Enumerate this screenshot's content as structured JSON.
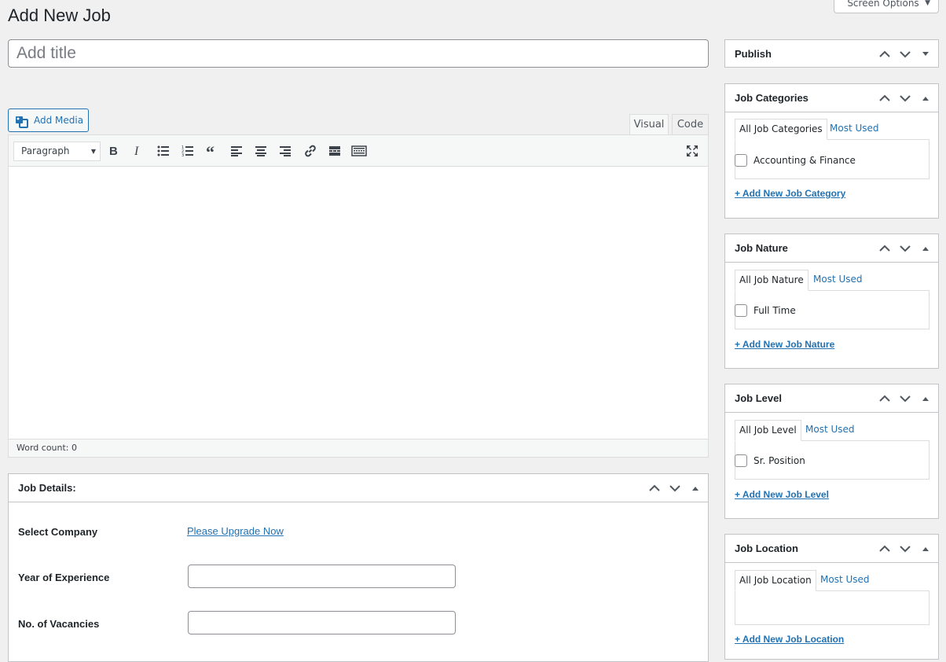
{
  "page": {
    "title": "Add New Job",
    "screen_options": "Screen Options"
  },
  "title_field": {
    "placeholder": "Add title"
  },
  "editor": {
    "add_media": "Add Media",
    "tab_visual": "Visual",
    "tab_code": "Code",
    "format_select": "Paragraph",
    "toolbar": [
      "bold-icon",
      "italic-icon",
      "bullet-list-icon",
      "numbered-list-icon",
      "blockquote-icon",
      "align-left-icon",
      "align-center-icon",
      "align-right-icon",
      "link-icon",
      "read-more-icon",
      "toolbar-toggle-icon",
      "fullscreen-icon"
    ],
    "word_count": "Word count: 0"
  },
  "job_details": {
    "title": "Job Details:",
    "select_company_label": "Select Company",
    "select_company_link": "Please Upgrade Now",
    "experience_label": "Year of Experience",
    "experience_value": "",
    "vacancies_label": "No. of Vacancies",
    "vacancies_value": ""
  },
  "sidebar": {
    "publish": {
      "title": "Publish"
    },
    "categories": {
      "title": "Job Categories",
      "tab_all": "All Job Categories",
      "tab_most": "Most Used",
      "items": [
        "Accounting & Finance"
      ],
      "add_link": "+ Add New Job Category"
    },
    "nature": {
      "title": "Job Nature",
      "tab_all": "All Job Nature",
      "tab_most": "Most Used",
      "items": [
        "Full Time"
      ],
      "add_link": "+ Add New Job Nature"
    },
    "level": {
      "title": "Job Level",
      "tab_all": "All Job Level",
      "tab_most": "Most Used",
      "items": [
        "Sr. Position"
      ],
      "add_link": "+ Add New Job Level"
    },
    "location": {
      "title": "Job Location",
      "tab_all": "All Job Location",
      "tab_most": "Most Used",
      "items": [],
      "add_link": "+ Add New Job Location"
    }
  },
  "colors": {
    "accent": "#2271b1",
    "background": "#f0f0f1",
    "border": "#c3c4c7"
  }
}
